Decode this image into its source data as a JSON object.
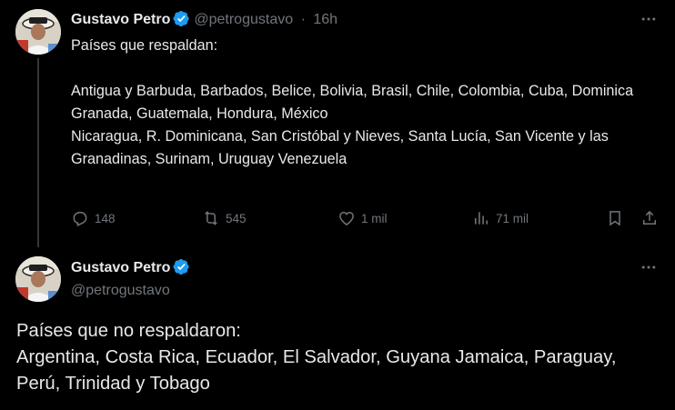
{
  "tweet1": {
    "author_name": "Gustavo Petro",
    "handle": "@petrogustavo",
    "separator": "·",
    "time": "16h",
    "lines": [
      "Países que respaldan:",
      "",
      "Antigua y Barbuda, Barbados, Belice, Bolivia, Brasil, Chile, Colombia, Cuba, Dominica",
      "Granada, Guatemala, Hondura, México",
      "Nicaragua, R. Dominicana, San Cristóbal y Nieves, Santa Lucía, San Vicente y las Granadinas, Surinam, Uruguay Venezuela"
    ],
    "actions": {
      "replies": "148",
      "reposts": "545",
      "likes": "1 mil",
      "views": "71 mil"
    }
  },
  "tweet2": {
    "author_name": "Gustavo Petro",
    "handle": "@petrogustavo",
    "lines": [
      "Países que no respaldaron:",
      "Argentina, Costa Rica, Ecuador, El Salvador, Guyana Jamaica, Paraguay, Perú, Trinidad y Tobago"
    ]
  },
  "icons": {
    "verified": "verified-badge-icon",
    "more": "more-horizontal-icon",
    "reply": "reply-icon",
    "repost": "repost-icon",
    "like": "heart-icon",
    "views": "views-chart-icon",
    "bookmark": "bookmark-icon",
    "share": "share-icon"
  },
  "colors": {
    "background": "#000000",
    "text": "#e7e9ea",
    "secondary": "#71767b",
    "verified": "#1d9bf0",
    "thread_line": "#333639"
  }
}
